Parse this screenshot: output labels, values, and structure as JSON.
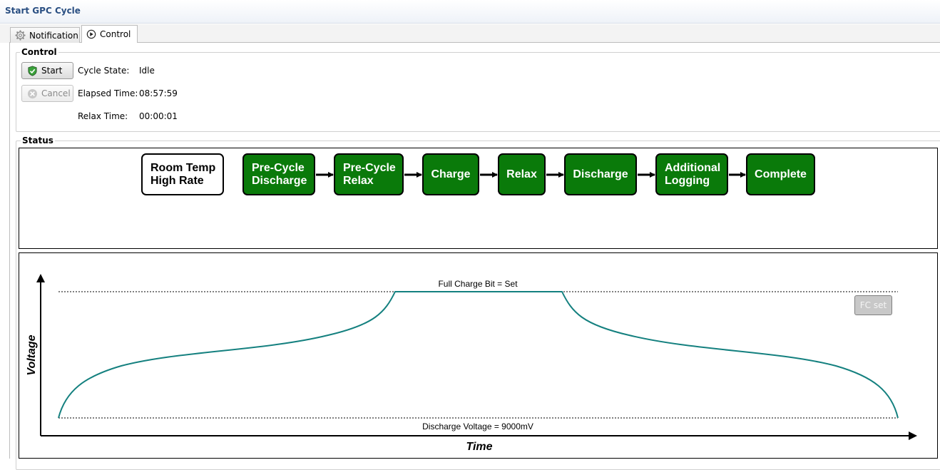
{
  "window": {
    "title": "Start GPC Cycle"
  },
  "tabs": [
    {
      "label": "Notification",
      "icon": "gear-icon"
    },
    {
      "label": "Control",
      "icon": "play-circle-icon"
    }
  ],
  "control": {
    "group_label": "Control",
    "start_label": "Start",
    "cancel_label": "Cancel",
    "cycle_state_label": "Cycle State:",
    "cycle_state_value": "Idle",
    "elapsed_label": "Elapsed Time:",
    "elapsed_value": "08:57:59",
    "relax_label": "Relax Time:",
    "relax_value": "00:00:01"
  },
  "status": {
    "group_label": "Status",
    "steps": [
      {
        "line1": "Room Temp",
        "line2": "High Rate",
        "active": false
      },
      {
        "line1": "Pre-Cycle",
        "line2": "Discharge",
        "active": true
      },
      {
        "line1": "Pre-Cycle",
        "line2": "Relax",
        "active": true
      },
      {
        "line1": "Charge",
        "line2": "",
        "active": true
      },
      {
        "line1": "Relax",
        "line2": "",
        "active": true
      },
      {
        "line1": "Discharge",
        "line2": "",
        "active": true
      },
      {
        "line1": "Additional",
        "line2": "Logging",
        "active": true
      },
      {
        "line1": "Complete",
        "line2": "",
        "active": true
      }
    ],
    "colors": {
      "active": "#0a7a0a",
      "inactive": "#ffffff"
    }
  },
  "chart": {
    "x_label": "Time",
    "y_label": "Voltage",
    "top_line_label": "Full Charge Bit = Set",
    "bottom_line_label": "Discharge Voltage = 9000mV",
    "fc_button_label": "FC set",
    "curve_color": "#14807f"
  }
}
